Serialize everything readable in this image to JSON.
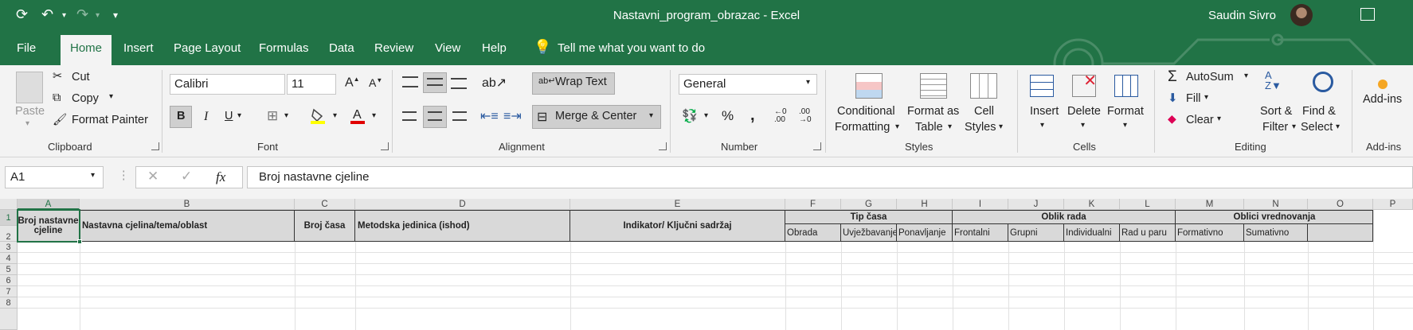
{
  "titlebar": {
    "doc_title": "Nastavni_program_obrazac  -  Excel",
    "user_name": "Saudin Sivro"
  },
  "menu": {
    "tabs": [
      "File",
      "Home",
      "Insert",
      "Page Layout",
      "Formulas",
      "Data",
      "Review",
      "View",
      "Help"
    ],
    "tell_me": "Tell me what you want to do"
  },
  "ribbon": {
    "clipboard": {
      "label": "Clipboard",
      "paste": "Paste",
      "cut": "Cut",
      "copy": "Copy",
      "format_painter": "Format Painter"
    },
    "font": {
      "label": "Font",
      "font_name": "Calibri",
      "font_size": "11",
      "bold": "B",
      "italic": "I",
      "underline": "U"
    },
    "alignment": {
      "label": "Alignment",
      "wrap_text": "Wrap Text",
      "merge_center": "Merge & Center"
    },
    "number": {
      "label": "Number",
      "format": "General",
      "percent": "%",
      "comma": ","
    },
    "styles": {
      "label": "Styles",
      "conditional": "Conditional",
      "formatting": "Formatting",
      "format_as": "Format as",
      "table": "Table",
      "cell": "Cell",
      "cell_styles": "Styles"
    },
    "cells": {
      "label": "Cells",
      "insert": "Insert",
      "delete": "Delete",
      "format": "Format"
    },
    "editing": {
      "label": "Editing",
      "autosum": "AutoSum",
      "fill": "Fill",
      "clear": "Clear",
      "sort": "Sort &",
      "filter": "Filter",
      "find": "Find &",
      "select": "Select"
    },
    "addins": {
      "label": "Add-ins",
      "addins": "Add-ins"
    }
  },
  "formula_bar": {
    "name_box": "A1",
    "fx": "fx",
    "content": "Broj nastavne cjeline"
  },
  "columns": [
    "A",
    "B",
    "C",
    "D",
    "E",
    "F",
    "G",
    "H",
    "I",
    "J",
    "K",
    "L",
    "M",
    "N",
    "O",
    "P"
  ],
  "rows": [
    "1",
    "2",
    "3",
    "4",
    "5",
    "6",
    "7",
    "8"
  ],
  "sheet": {
    "a1": "Broj nastavne cjeline",
    "b1": "Nastavna cjelina/tema/oblast",
    "c1": "Broj časa",
    "d1": "Metodska jedinica (ishod)",
    "e1": "Indikator/ Ključni sadržaj",
    "tip_casa": "Tip časa",
    "oblik_rada": "Oblik rada",
    "oblici_vrednovanja": "Oblici vrednovanja",
    "f2": "Obrada",
    "g2": "Uvježbavanje",
    "h2": "Ponavljanje",
    "i2": "Frontalni",
    "j2": "Grupni",
    "k2": "Individualni",
    "l2": "Rad u paru",
    "m2": "Formativno",
    "n2": "Sumativno"
  },
  "colors": {
    "excel_green": "#217346",
    "ribbon_bg": "#f3f3f3",
    "header_fill": "#d9d9d9"
  }
}
